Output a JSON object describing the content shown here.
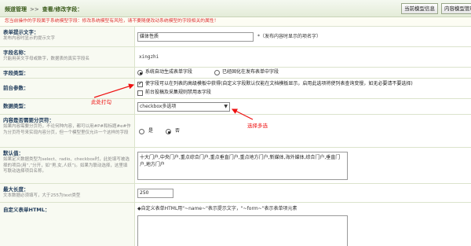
{
  "breadcrumb": {
    "part1": "频道管理",
    "sep": ">>",
    "part2": "查看/修改字段："
  },
  "toolbar": {
    "current_model_info": "当前模型信息",
    "content_model_manage": "内容模型管理"
  },
  "notice": "您当前操作的字段属于系统模型字段：修改系统模型有风险，请不要随便改动系统模型的字段相关的属性！",
  "fields": {
    "prompt_text": {
      "label": "表单提示文字：",
      "desc": "发布内容时显示的提示文字",
      "value": "媒体性质",
      "hint": "*（发布内容时显示的项名字）"
    },
    "field_name": {
      "label": "字段名称：",
      "desc": "只能用英文字母或数字，数据表的真实字段名",
      "value": "xingzhi"
    },
    "field_type": {
      "label": "字段类型：",
      "opt1": "系统自动生成表单字段",
      "opt2": "已经固化在发布表单中字段"
    },
    "frontend": {
      "label": "前台参数：",
      "opt1": "使字段可以在列表的高级模板中获得(自定义字段默认仅能在文档模板显示，启用此选项将使列表查询变慢，如无必要请不要选择)",
      "opt2": "前台投稿及采集规则禁用本字段"
    },
    "data_type": {
      "label": "数据类型：",
      "value": "checkbox多选项"
    },
    "paging": {
      "label": "内容是否需要分页符：",
      "desc": "如果内容需要分页符，不论何种内容，都可以用#P#和标题#e#作为分页符号来实现内容分页，但一个模型里仅允许一个这样的字段",
      "yes": "是",
      "no": "否"
    },
    "default_value": {
      "label": "默认值：",
      "desc": "如果定义数据类型为select、radio、checkbox时，此处填写被选择的项目(用“,”分开，如“男,女,人妖”)。如果为联动选择，这里填写联动选择项目名称。",
      "value": "十大门户,中央门户,重点综合门户,重点垂直门户,重点地方门户,新媒体,海外媒体,综合门户,垂直门户,地方门户"
    },
    "max_length": {
      "label": "最大长度：",
      "desc": "文本数据必须填写，大于255为text类型",
      "value": "250"
    },
    "custom_html": {
      "label": "自定义表单HTML：",
      "hint": "◆自定义表单HTML用\"~name~\"表示提示文字，\"~form~\"表示表单项元素"
    }
  },
  "annotations": {
    "check_here": "此处打勾",
    "multi_select": "选择多选"
  },
  "colors": {
    "annotation": "#ee1111",
    "notice_text": "#dd3333",
    "label_text": "#1e3a5a"
  }
}
